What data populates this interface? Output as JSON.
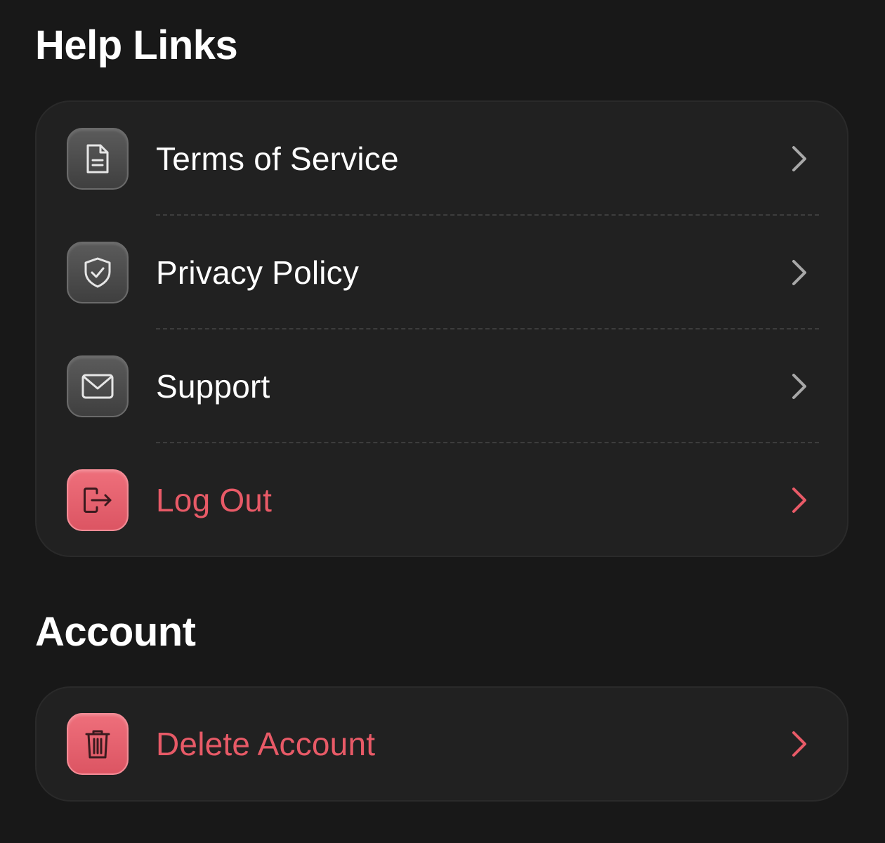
{
  "help_links": {
    "title": "Help Links",
    "items": [
      {
        "label": "Terms of Service",
        "icon": "document-icon",
        "style": "default"
      },
      {
        "label": "Privacy Policy",
        "icon": "shield-check-icon",
        "style": "default"
      },
      {
        "label": "Support",
        "icon": "envelope-icon",
        "style": "default"
      },
      {
        "label": "Log Out",
        "icon": "logout-icon",
        "style": "danger"
      }
    ]
  },
  "account": {
    "title": "Account",
    "items": [
      {
        "label": "Delete Account",
        "icon": "trash-icon",
        "style": "danger"
      }
    ]
  },
  "colors": {
    "background": "#181818",
    "card": "#212121",
    "danger": "#e85a67",
    "chevron_default": "#a8a8a8",
    "icon_tile_gray": "#4d4d4d",
    "icon_tile_red": "#e5606d"
  }
}
